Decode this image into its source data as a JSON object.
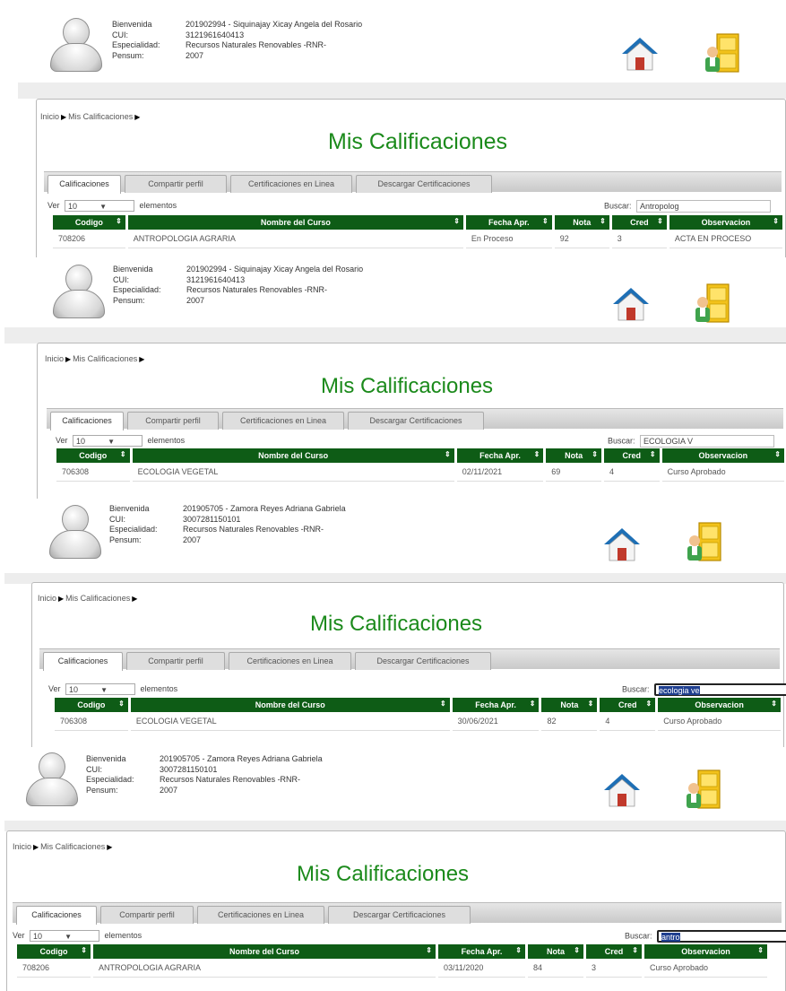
{
  "header": {
    "labels": [
      "Bienvenida",
      "CUI:",
      "Especialidad:",
      "Pensum:"
    ]
  },
  "panels": [
    {
      "student": "201902994 - Siquinajay Xicay Angela del Rosario",
      "cui": "3121961640413",
      "specialty": "Recursos Naturales Renovables -RNR-",
      "pensum": "2007",
      "search": "Antropolog",
      "row": {
        "codigo": "708206",
        "curso": "ANTROPOLOGIA AGRARIA",
        "fecha": "En Proceso",
        "nota": "92",
        "cred": "3",
        "obs": "ACTA EN PROCESO"
      }
    },
    {
      "student": "201902994 - Siquinajay Xicay Angela del Rosario",
      "cui": "3121961640413",
      "specialty": "Recursos Naturales Renovables -RNR-",
      "pensum": "2007",
      "search": "ECOLOGIA V",
      "row": {
        "codigo": "706308",
        "curso": "ECOLOGIA VEGETAL",
        "fecha": "02/11/2021",
        "nota": "69",
        "cred": "4",
        "obs": "Curso Aprobado"
      }
    },
    {
      "student": "201905705 - Zamora Reyes Adriana Gabriela",
      "cui": "3007281150101",
      "specialty": "Recursos Naturales Renovables -RNR-",
      "pensum": "2007",
      "search": "ecologia ve",
      "row": {
        "codigo": "706308",
        "curso": "ECOLOGIA VEGETAL",
        "fecha": "30/06/2021",
        "nota": "82",
        "cred": "4",
        "obs": "Curso Aprobado"
      }
    },
    {
      "student": "201905705 - Zamora Reyes Adriana Gabriela",
      "cui": "3007281150101",
      "specialty": "Recursos Naturales Renovables -RNR-",
      "pensum": "2007",
      "search": "antro",
      "row": {
        "codigo": "708206",
        "curso": "ANTROPOLOGIA AGRARIA",
        "fecha": "03/11/2020",
        "nota": "84",
        "cred": "3",
        "obs": "Curso Aprobado"
      }
    }
  ],
  "page": {
    "breadcrumb_home": "Inicio",
    "breadcrumb_current": "Mis Calificaciones",
    "title": "Mis Calificaciones",
    "tabs": [
      "Calificaciones",
      "Compartir perfil",
      "Certificaciones en Linea",
      "Descargar Certificaciones"
    ],
    "ver_label": "Ver",
    "ver_value": "10",
    "elementos_label": "elementos",
    "buscar_label": "Buscar:"
  },
  "table": {
    "columns": [
      "Codigo",
      "Nombre del Curso",
      "Fecha Apr.",
      "Nota",
      "Cred",
      "Observacion"
    ]
  },
  "colors": {
    "accent_green": "#0e5c16",
    "title_green": "#1b8a1b"
  },
  "icons": [
    "user-avatar-icon",
    "home-icon",
    "exit-door-icon",
    "sort-icon",
    "chevron-down-icon"
  ]
}
